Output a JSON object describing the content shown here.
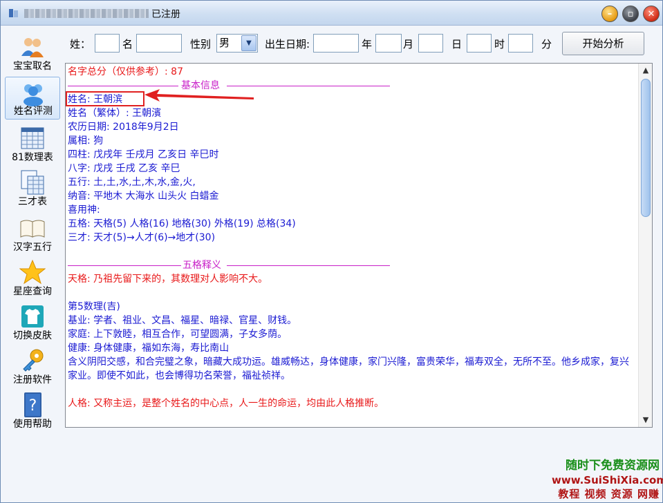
{
  "window": {
    "status": "已注册"
  },
  "sidebar": {
    "items": [
      {
        "label": "宝宝取名"
      },
      {
        "label": "姓名评测"
      },
      {
        "label": "81数理表"
      },
      {
        "label": "三才表"
      },
      {
        "label": "汉字五行"
      },
      {
        "label": "星座查询"
      },
      {
        "label": "切换皮肤"
      },
      {
        "label": "注册软件"
      },
      {
        "label": "使用帮助"
      }
    ]
  },
  "form": {
    "surname_label": "姓：",
    "surname_value": "",
    "name_label": "名",
    "name_value": "",
    "gender_label": "性别",
    "gender_value": "男",
    "birth_label": "出生日期:",
    "year_value": "",
    "year_label": "年",
    "month_value": "",
    "month_label": "月",
    "day_value": "",
    "day_label": "日",
    "hour_value": "",
    "hour_label": "时",
    "minute_value": "",
    "minute_label": "分",
    "analyze_button": "开始分析"
  },
  "result": {
    "score_line": "名字总分（仅供参考）: 87",
    "basic_header": "基本信息",
    "name_line": "姓名: 王朝滨",
    "traditional_line": "姓名（繁体）: 王朝濱",
    "lunar_line": "农历日期: 2018年9月2日",
    "zodiac_line": "属相: 狗",
    "pillars_line": "四柱: 戊戌年 壬戌月 乙亥日 辛巳时",
    "bazi_line": "八字: 戊戌 壬戌 乙亥 辛巳",
    "wuxing_line": "五行: 土,土,水,土,木,水,金,火,",
    "nayin_line": "纳音: 平地木 大海水 山头火 白蜡金",
    "xiyong_line": "喜用神:",
    "wuge_line": "五格: 天格(5) 人格(16) 地格(30) 外格(19) 总格(34)",
    "sancai_line": "三才: 天才(5)→人才(6)→地才(30)",
    "wuge_header": "五格释义",
    "tiange_line": "天格: 乃祖先留下来的，其数理对人影响不大。",
    "num5_line": "第5数理(吉)",
    "jiye_line": "基业: 学者、祖业、文昌、福星、暗禄、官星、财钱。",
    "jiating_line": "家庭: 上下敦睦，相互合作，可望圆满，子女多荫。",
    "jiankang_line": "健康: 身体健康，福如东海，寿比南山",
    "hanyi_line": "含义阴阳交感，和合完璧之象，暗藏大成功运。雄威畅达，身体健康，家门兴隆，富贵荣华，福寿双全，无所不至。他乡成家，复兴家业。即使不如此，也会博得功名荣誉，福祉祯祥。",
    "renge_line": "人格: 又称主运，是整个姓名的中心点，人一生的命运，均由此人格推断。"
  },
  "watermark": {
    "line1": "随时下免费资源网",
    "line2": "www.SuiShiXia.com",
    "line3": "教程 视频 资源 网赚"
  },
  "colors": {
    "red": "#e8191a",
    "blue": "#1a1ad2",
    "magenta": "#c81ec8"
  }
}
